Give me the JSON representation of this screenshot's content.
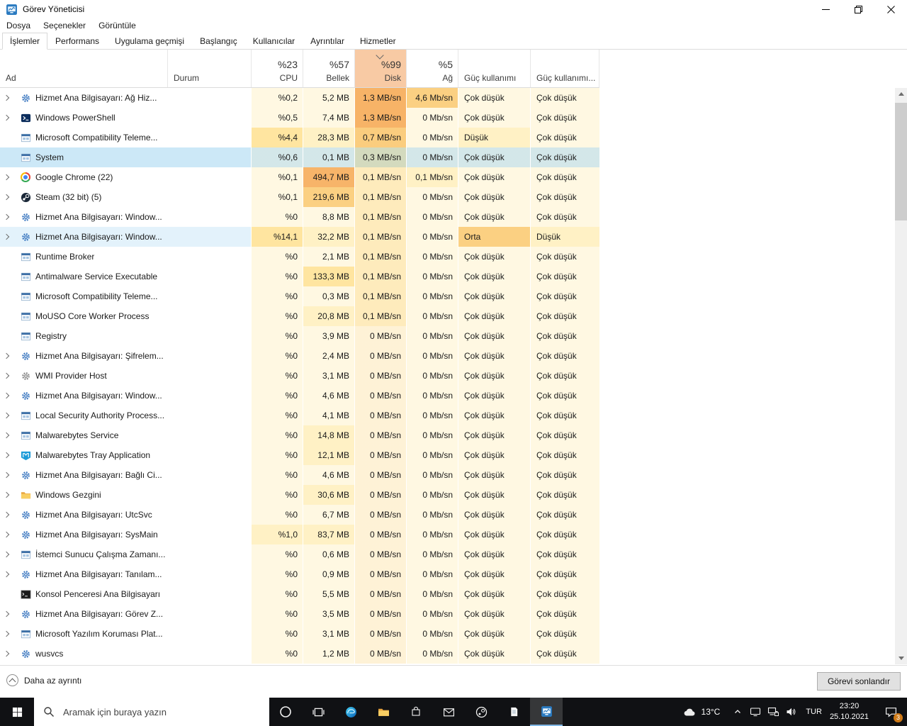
{
  "window": {
    "title": "Görev Yöneticisi"
  },
  "menu": {
    "items": [
      "Dosya",
      "Seçenekler",
      "Görüntüle"
    ]
  },
  "tabs": [
    {
      "label": "İşlemler",
      "active": true
    },
    {
      "label": "Performans",
      "active": false
    },
    {
      "label": "Uygulama geçmişi",
      "active": false
    },
    {
      "label": "Başlangıç",
      "active": false
    },
    {
      "label": "Kullanıcılar",
      "active": false
    },
    {
      "label": "Ayrıntılar",
      "active": false
    },
    {
      "label": "Hizmetler",
      "active": false
    }
  ],
  "table": {
    "columns": {
      "name": "Ad",
      "status": "Durum",
      "usage": [
        {
          "pct": "%23",
          "label": "CPU",
          "sorted": false
        },
        {
          "pct": "%57",
          "label": "Bellek",
          "sorted": false
        },
        {
          "pct": "%99",
          "label": "Disk",
          "sorted": true
        },
        {
          "pct": "%5",
          "label": "Ağ",
          "sorted": false
        }
      ],
      "power": "Güç kullanımı",
      "power_trend": "Güç kullanımı..."
    },
    "rows": [
      {
        "name": "Hizmet Ana Bilgisayarı: Ağ Hiz...",
        "icon": "svchost-icon",
        "expandable": true,
        "status": "",
        "cpu": "%0,2",
        "memory": "5,2 MB",
        "disk": "1,3 MB/sn",
        "network": "4,6 Mb/sn",
        "power": "Çok düşük",
        "power_trend": "Çok düşük",
        "heat": [
          0,
          0,
          4,
          3,
          0,
          0
        ],
        "selected": false,
        "highlighted": false
      },
      {
        "name": "Windows PowerShell",
        "icon": "powershell-icon",
        "expandable": true,
        "status": "",
        "cpu": "%0,5",
        "memory": "7,4 MB",
        "disk": "1,3 MB/sn",
        "network": "0 Mb/sn",
        "power": "Çok düşük",
        "power_trend": "Çok düşük",
        "heat": [
          0,
          0,
          4,
          0,
          0,
          0
        ],
        "selected": false,
        "highlighted": false
      },
      {
        "name": "Microsoft Compatibility Teleme...",
        "icon": "window-icon",
        "expandable": false,
        "status": "",
        "cpu": "%4,4",
        "memory": "28,3 MB",
        "disk": "0,7 MB/sn",
        "network": "0 Mb/sn",
        "power": "Düşük",
        "power_trend": "Çok düşük",
        "heat": [
          2,
          1,
          3,
          0,
          1,
          0
        ],
        "selected": false,
        "highlighted": false
      },
      {
        "name": "System",
        "icon": "window-icon",
        "expandable": false,
        "status": "",
        "cpu": "%0,6",
        "memory": "0,1 MB",
        "disk": "0,3 MB/sn",
        "network": "0 Mb/sn",
        "power": "Çok düşük",
        "power_trend": "Çok düşük",
        "heat": [
          0,
          0,
          2,
          0,
          0,
          0
        ],
        "selected": true,
        "highlighted": false
      },
      {
        "name": "Google Chrome (22)",
        "icon": "chrome-icon",
        "expandable": true,
        "status": "",
        "cpu": "%0,1",
        "memory": "494,7 MB",
        "disk": "0,1 MB/sn",
        "network": "0,1 Mb/sn",
        "power": "Çok düşük",
        "power_trend": "Çok düşük",
        "heat": [
          0,
          4,
          1,
          1,
          0,
          0
        ],
        "selected": false,
        "highlighted": false
      },
      {
        "name": "Steam (32 bit) (5)",
        "icon": "steam-icon",
        "expandable": true,
        "status": "",
        "cpu": "%0,1",
        "memory": "219,6 MB",
        "disk": "0,1 MB/sn",
        "network": "0 Mb/sn",
        "power": "Çok düşük",
        "power_trend": "Çok düşük",
        "heat": [
          0,
          3,
          1,
          0,
          0,
          0
        ],
        "selected": false,
        "highlighted": false
      },
      {
        "name": "Hizmet Ana Bilgisayarı: Window...",
        "icon": "svchost-icon",
        "expandable": true,
        "status": "",
        "cpu": "%0",
        "memory": "8,8 MB",
        "disk": "0,1 MB/sn",
        "network": "0 Mb/sn",
        "power": "Çok düşük",
        "power_trend": "Çok düşük",
        "heat": [
          0,
          0,
          1,
          0,
          0,
          0
        ],
        "selected": false,
        "highlighted": false
      },
      {
        "name": "Hizmet Ana Bilgisayarı: Window...",
        "icon": "svchost-icon",
        "expandable": true,
        "status": "",
        "cpu": "%14,1",
        "memory": "32,2 MB",
        "disk": "0,1 MB/sn",
        "network": "0 Mb/sn",
        "power": "Orta",
        "power_trend": "Düşük",
        "heat": [
          2,
          1,
          1,
          0,
          3,
          1
        ],
        "selected": false,
        "highlighted": true
      },
      {
        "name": "Runtime Broker",
        "icon": "window-icon",
        "expandable": false,
        "status": "",
        "cpu": "%0",
        "memory": "2,1 MB",
        "disk": "0,1 MB/sn",
        "network": "0 Mb/sn",
        "power": "Çok düşük",
        "power_trend": "Çok düşük",
        "heat": [
          0,
          0,
          1,
          0,
          0,
          0
        ],
        "selected": false,
        "highlighted": false
      },
      {
        "name": "Antimalware Service Executable",
        "icon": "window-icon",
        "expandable": false,
        "status": "",
        "cpu": "%0",
        "memory": "133,3 MB",
        "disk": "0,1 MB/sn",
        "network": "0 Mb/sn",
        "power": "Çok düşük",
        "power_trend": "Çok düşük",
        "heat": [
          0,
          2,
          1,
          0,
          0,
          0
        ],
        "selected": false,
        "highlighted": false
      },
      {
        "name": "Microsoft Compatibility Teleme...",
        "icon": "window-icon",
        "expandable": false,
        "status": "",
        "cpu": "%0",
        "memory": "0,3 MB",
        "disk": "0,1 MB/sn",
        "network": "0 Mb/sn",
        "power": "Çok düşük",
        "power_trend": "Çok düşük",
        "heat": [
          0,
          0,
          1,
          0,
          0,
          0
        ],
        "selected": false,
        "highlighted": false
      },
      {
        "name": "MoUSO Core Worker Process",
        "icon": "window-icon",
        "expandable": false,
        "status": "",
        "cpu": "%0",
        "memory": "20,8 MB",
        "disk": "0,1 MB/sn",
        "network": "0 Mb/sn",
        "power": "Çok düşük",
        "power_trend": "Çok düşük",
        "heat": [
          0,
          1,
          1,
          0,
          0,
          0
        ],
        "selected": false,
        "highlighted": false
      },
      {
        "name": "Registry",
        "icon": "window-icon",
        "expandable": false,
        "status": "",
        "cpu": "%0",
        "memory": "3,9 MB",
        "disk": "0 MB/sn",
        "network": "0 Mb/sn",
        "power": "Çok düşük",
        "power_trend": "Çok düşük",
        "heat": [
          0,
          0,
          0,
          0,
          0,
          0
        ],
        "selected": false,
        "highlighted": false
      },
      {
        "name": "Hizmet Ana Bilgisayarı: Şifrelem...",
        "icon": "svchost-icon",
        "expandable": true,
        "status": "",
        "cpu": "%0",
        "memory": "2,4 MB",
        "disk": "0 MB/sn",
        "network": "0 Mb/sn",
        "power": "Çok düşük",
        "power_trend": "Çok düşük",
        "heat": [
          0,
          0,
          0,
          0,
          0,
          0
        ],
        "selected": false,
        "highlighted": false
      },
      {
        "name": "WMI Provider Host",
        "icon": "wmi-icon",
        "expandable": true,
        "status": "",
        "cpu": "%0",
        "memory": "3,1 MB",
        "disk": "0 MB/sn",
        "network": "0 Mb/sn",
        "power": "Çok düşük",
        "power_trend": "Çok düşük",
        "heat": [
          0,
          0,
          0,
          0,
          0,
          0
        ],
        "selected": false,
        "highlighted": false
      },
      {
        "name": "Hizmet Ana Bilgisayarı: Window...",
        "icon": "svchost-icon",
        "expandable": true,
        "status": "",
        "cpu": "%0",
        "memory": "4,6 MB",
        "disk": "0 MB/sn",
        "network": "0 Mb/sn",
        "power": "Çok düşük",
        "power_trend": "Çok düşük",
        "heat": [
          0,
          0,
          0,
          0,
          0,
          0
        ],
        "selected": false,
        "highlighted": false
      },
      {
        "name": "Local Security Authority Process...",
        "icon": "window-icon",
        "expandable": true,
        "status": "",
        "cpu": "%0",
        "memory": "4,1 MB",
        "disk": "0 MB/sn",
        "network": "0 Mb/sn",
        "power": "Çok düşük",
        "power_trend": "Çok düşük",
        "heat": [
          0,
          0,
          0,
          0,
          0,
          0
        ],
        "selected": false,
        "highlighted": false
      },
      {
        "name": "Malwarebytes Service",
        "icon": "window-icon",
        "expandable": true,
        "status": "",
        "cpu": "%0",
        "memory": "14,8 MB",
        "disk": "0 MB/sn",
        "network": "0 Mb/sn",
        "power": "Çok düşük",
        "power_trend": "Çok düşük",
        "heat": [
          0,
          1,
          0,
          0,
          0,
          0
        ],
        "selected": false,
        "highlighted": false
      },
      {
        "name": "Malwarebytes Tray Application",
        "icon": "malwarebytes-icon",
        "expandable": true,
        "status": "",
        "cpu": "%0",
        "memory": "12,1 MB",
        "disk": "0 MB/sn",
        "network": "0 Mb/sn",
        "power": "Çok düşük",
        "power_trend": "Çok düşük",
        "heat": [
          0,
          1,
          0,
          0,
          0,
          0
        ],
        "selected": false,
        "highlighted": false
      },
      {
        "name": "Hizmet Ana Bilgisayarı: Bağlı Ci...",
        "icon": "svchost-icon",
        "expandable": true,
        "status": "",
        "cpu": "%0",
        "memory": "4,6 MB",
        "disk": "0 MB/sn",
        "network": "0 Mb/sn",
        "power": "Çok düşük",
        "power_trend": "Çok düşük",
        "heat": [
          0,
          0,
          0,
          0,
          0,
          0
        ],
        "selected": false,
        "highlighted": false
      },
      {
        "name": "Windows Gezgini",
        "icon": "folder-icon",
        "expandable": true,
        "status": "",
        "cpu": "%0",
        "memory": "30,6 MB",
        "disk": "0 MB/sn",
        "network": "0 Mb/sn",
        "power": "Çok düşük",
        "power_trend": "Çok düşük",
        "heat": [
          0,
          1,
          0,
          0,
          0,
          0
        ],
        "selected": false,
        "highlighted": false
      },
      {
        "name": "Hizmet Ana Bilgisayarı: UtcSvc",
        "icon": "svchost-icon",
        "expandable": true,
        "status": "",
        "cpu": "%0",
        "memory": "6,7 MB",
        "disk": "0 MB/sn",
        "network": "0 Mb/sn",
        "power": "Çok düşük",
        "power_trend": "Çok düşük",
        "heat": [
          0,
          0,
          0,
          0,
          0,
          0
        ],
        "selected": false,
        "highlighted": false
      },
      {
        "name": "Hizmet Ana Bilgisayarı: SysMain",
        "icon": "svchost-icon",
        "expandable": true,
        "status": "",
        "cpu": "%1,0",
        "memory": "83,7 MB",
        "disk": "0 MB/sn",
        "network": "0 Mb/sn",
        "power": "Çok düşük",
        "power_trend": "Çok düşük",
        "heat": [
          1,
          1,
          0,
          0,
          0,
          0
        ],
        "selected": false,
        "highlighted": false
      },
      {
        "name": "İstemci Sunucu Çalışma Zamanı...",
        "icon": "window-icon",
        "expandable": true,
        "status": "",
        "cpu": "%0",
        "memory": "0,6 MB",
        "disk": "0 MB/sn",
        "network": "0 Mb/sn",
        "power": "Çok düşük",
        "power_trend": "Çok düşük",
        "heat": [
          0,
          0,
          0,
          0,
          0,
          0
        ],
        "selected": false,
        "highlighted": false
      },
      {
        "name": "Hizmet Ana Bilgisayarı: Tanılam...",
        "icon": "svchost-icon",
        "expandable": true,
        "status": "",
        "cpu": "%0",
        "memory": "0,9 MB",
        "disk": "0 MB/sn",
        "network": "0 Mb/sn",
        "power": "Çok düşük",
        "power_trend": "Çok düşük",
        "heat": [
          0,
          0,
          0,
          0,
          0,
          0
        ],
        "selected": false,
        "highlighted": false
      },
      {
        "name": "Konsol Penceresi Ana Bilgisayarı",
        "icon": "console-icon",
        "expandable": false,
        "status": "",
        "cpu": "%0",
        "memory": "5,5 MB",
        "disk": "0 MB/sn",
        "network": "0 Mb/sn",
        "power": "Çok düşük",
        "power_trend": "Çok düşük",
        "heat": [
          0,
          0,
          0,
          0,
          0,
          0
        ],
        "selected": false,
        "highlighted": false
      },
      {
        "name": "Hizmet Ana Bilgisayarı: Görev Z...",
        "icon": "svchost-icon",
        "expandable": true,
        "status": "",
        "cpu": "%0",
        "memory": "3,5 MB",
        "disk": "0 MB/sn",
        "network": "0 Mb/sn",
        "power": "Çok düşük",
        "power_trend": "Çok düşük",
        "heat": [
          0,
          0,
          0,
          0,
          0,
          0
        ],
        "selected": false,
        "highlighted": false
      },
      {
        "name": "Microsoft Yazılım Koruması Plat...",
        "icon": "window-icon",
        "expandable": true,
        "status": "",
        "cpu": "%0",
        "memory": "3,1 MB",
        "disk": "0 MB/sn",
        "network": "0 Mb/sn",
        "power": "Çok düşük",
        "power_trend": "Çok düşük",
        "heat": [
          0,
          0,
          0,
          0,
          0,
          0
        ],
        "selected": false,
        "highlighted": false
      },
      {
        "name": "wusvcs",
        "icon": "svchost-icon",
        "expandable": true,
        "status": "",
        "cpu": "%0",
        "memory": "1,2 MB",
        "disk": "0 MB/sn",
        "network": "0 Mb/sn",
        "power": "Çok düşük",
        "power_trend": "Çok düşük",
        "heat": [
          0,
          0,
          0,
          0,
          0,
          0
        ],
        "selected": false,
        "highlighted": false
      }
    ]
  },
  "footer": {
    "less_detail": "Daha az ayrıntı",
    "end_task_button": "Görevi sonlandır"
  },
  "taskbar": {
    "search_placeholder": "Aramak için buraya yazın",
    "pinned": [
      "cortana",
      "task-view",
      "edge",
      "file-explorer",
      "store",
      "mail",
      "steam",
      "notepad",
      "task-manager"
    ],
    "active_app": "task-manager",
    "tray": {
      "temperature": "13°C",
      "tray_icons": [
        "chevron-up",
        "monitor",
        "network",
        "volume"
      ],
      "language": "TUR",
      "time": "23:20",
      "date": "25.10.2021",
      "notification_badge": "3"
    }
  },
  "colors": {
    "selection": "#cce8f7",
    "disk_header": "#f8caa4",
    "heat_scale": [
      "#fff8e2",
      "#fff1c5",
      "#ffe5a0",
      "#fbd082",
      "#f7b469"
    ],
    "taskbar": "#101114"
  }
}
